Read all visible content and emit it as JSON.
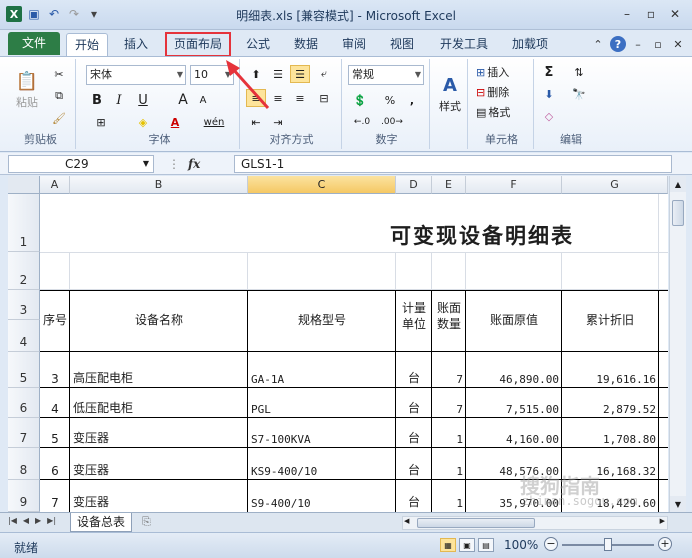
{
  "window": {
    "title": "明细表.xls  [兼容模式] - Microsoft Excel",
    "app_icon": "X"
  },
  "ribbon_tabs": {
    "file": "文件",
    "home": "开始",
    "insert": "插入",
    "page_layout": "页面布局",
    "formulas": "公式",
    "data": "数据",
    "review": "审阅",
    "view": "视图",
    "developer": "开发工具",
    "addins": "加载项"
  },
  "ribbon": {
    "clipboard": {
      "label": "剪贴板",
      "paste": "粘贴"
    },
    "font": {
      "label": "字体",
      "name": "宋体",
      "size": "10",
      "bold": "B",
      "italic": "I",
      "underline": "U",
      "grow": "A",
      "shrink": "A",
      "phonetic": "wén"
    },
    "alignment": {
      "label": "对齐方式"
    },
    "number": {
      "label": "数字",
      "format": "常规",
      "percent": "%",
      "comma": ","
    },
    "styles": {
      "label": "样式",
      "button": "样式"
    },
    "cells": {
      "label": "单元格",
      "insert": "插入",
      "delete": "删除",
      "format": "格式"
    },
    "editing": {
      "label": "编辑",
      "sum": "Σ"
    }
  },
  "formula_bar": {
    "name_box": "C29",
    "fx": "fx",
    "content": "GLS1-1"
  },
  "columns": [
    "A",
    "B",
    "C",
    "D",
    "E",
    "F",
    "G"
  ],
  "rows": [
    "1",
    "2",
    "3",
    "4",
    "5",
    "6",
    "7",
    "8",
    "9"
  ],
  "sheet": {
    "title": "可变现设备明细表",
    "headers": {
      "seq": "序号",
      "name": "设备名称",
      "spec": "规格型号",
      "unit_line1": "计量",
      "unit_line2": "单位",
      "qty_line1": "账面",
      "qty_line2": "数量",
      "orig": "账面原值",
      "depr": "累计折旧"
    },
    "data_rows": [
      {
        "seq": "3",
        "name": "高压配电柜",
        "spec": "GA-1A",
        "unit": "台",
        "qty": "7",
        "orig": "46,890.00",
        "depr": "19,616.16"
      },
      {
        "seq": "4",
        "name": "低压配电柜",
        "spec": "PGL",
        "unit": "台",
        "qty": "7",
        "orig": "7,515.00",
        "depr": "2,879.52"
      },
      {
        "seq": "5",
        "name": "变压器",
        "spec": "S7-100KVA",
        "unit": "台",
        "qty": "1",
        "orig": "4,160.00",
        "depr": "1,708.80"
      },
      {
        "seq": "6",
        "name": "变压器",
        "spec": "KS9-400/10",
        "unit": "台",
        "qty": "1",
        "orig": "48,576.00",
        "depr": "16,168.32"
      },
      {
        "seq": "7",
        "name": "变压器",
        "spec": "S9-400/10",
        "unit": "台",
        "qty": "1",
        "orig": "35,970.00",
        "depr": "18,429.60"
      }
    ]
  },
  "sheet_tabs": {
    "active": "设备总表"
  },
  "status": {
    "text": "就绪",
    "zoom": "100%"
  },
  "watermark": {
    "line1": "搜狗指南",
    "line2": "zhinan.sogou.com"
  },
  "colors": {
    "file_tab": "#2d7d46",
    "highlight_box": "#e5333b",
    "selected_col": "#f5c864"
  }
}
